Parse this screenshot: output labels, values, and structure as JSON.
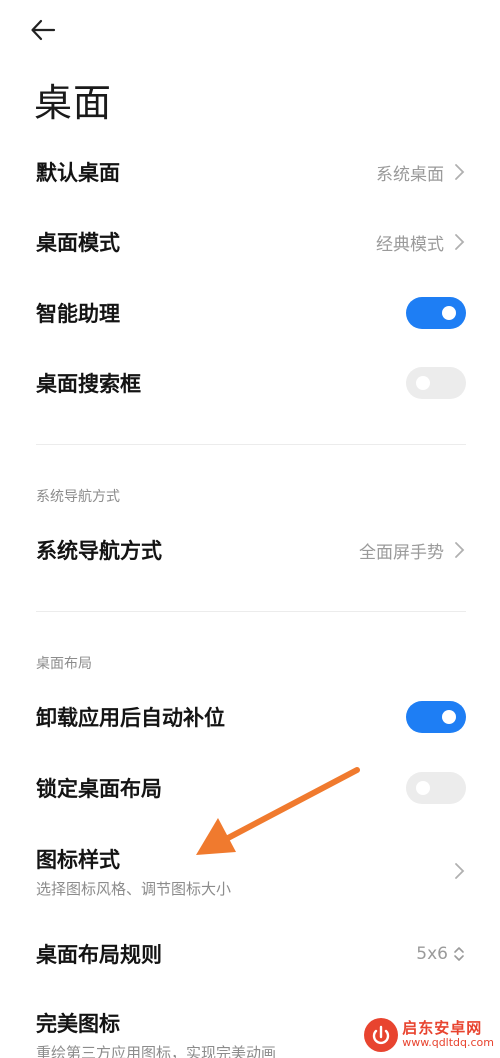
{
  "header": {
    "back_icon": "back-arrow-icon",
    "title": "桌面"
  },
  "rows": {
    "default_launcher": {
      "label": "默认桌面",
      "value": "系统桌面"
    },
    "launcher_mode": {
      "label": "桌面模式",
      "value": "经典模式"
    },
    "smart_assistant": {
      "label": "智能助理",
      "toggle": true
    },
    "search_bar": {
      "label": "桌面搜索框",
      "toggle": false
    },
    "navigation": {
      "label": "系统导航方式",
      "value": "全面屏手势"
    },
    "auto_fill": {
      "label": "卸载应用后自动补位",
      "toggle": true
    },
    "lock_layout": {
      "label": "锁定桌面布局",
      "toggle": false
    },
    "icon_style": {
      "label": "图标样式",
      "sub": "选择图标风格、调节图标大小"
    },
    "layout_grid": {
      "label": "桌面布局规则",
      "value": "5x6"
    },
    "perfect_icons": {
      "label": "完美图标",
      "sub": "重绘第三方应用图标，实现完美动画"
    }
  },
  "sections": {
    "navigation_header": "系统导航方式",
    "layout_header": "桌面布局"
  },
  "colors": {
    "accent": "#1e7ef4",
    "toggle_off": "#ececec",
    "annotation_arrow": "#f07a2e",
    "watermark": "#e8442f"
  },
  "watermark": {
    "title": "启东安卓网",
    "url": "www.qdltdq.com"
  }
}
